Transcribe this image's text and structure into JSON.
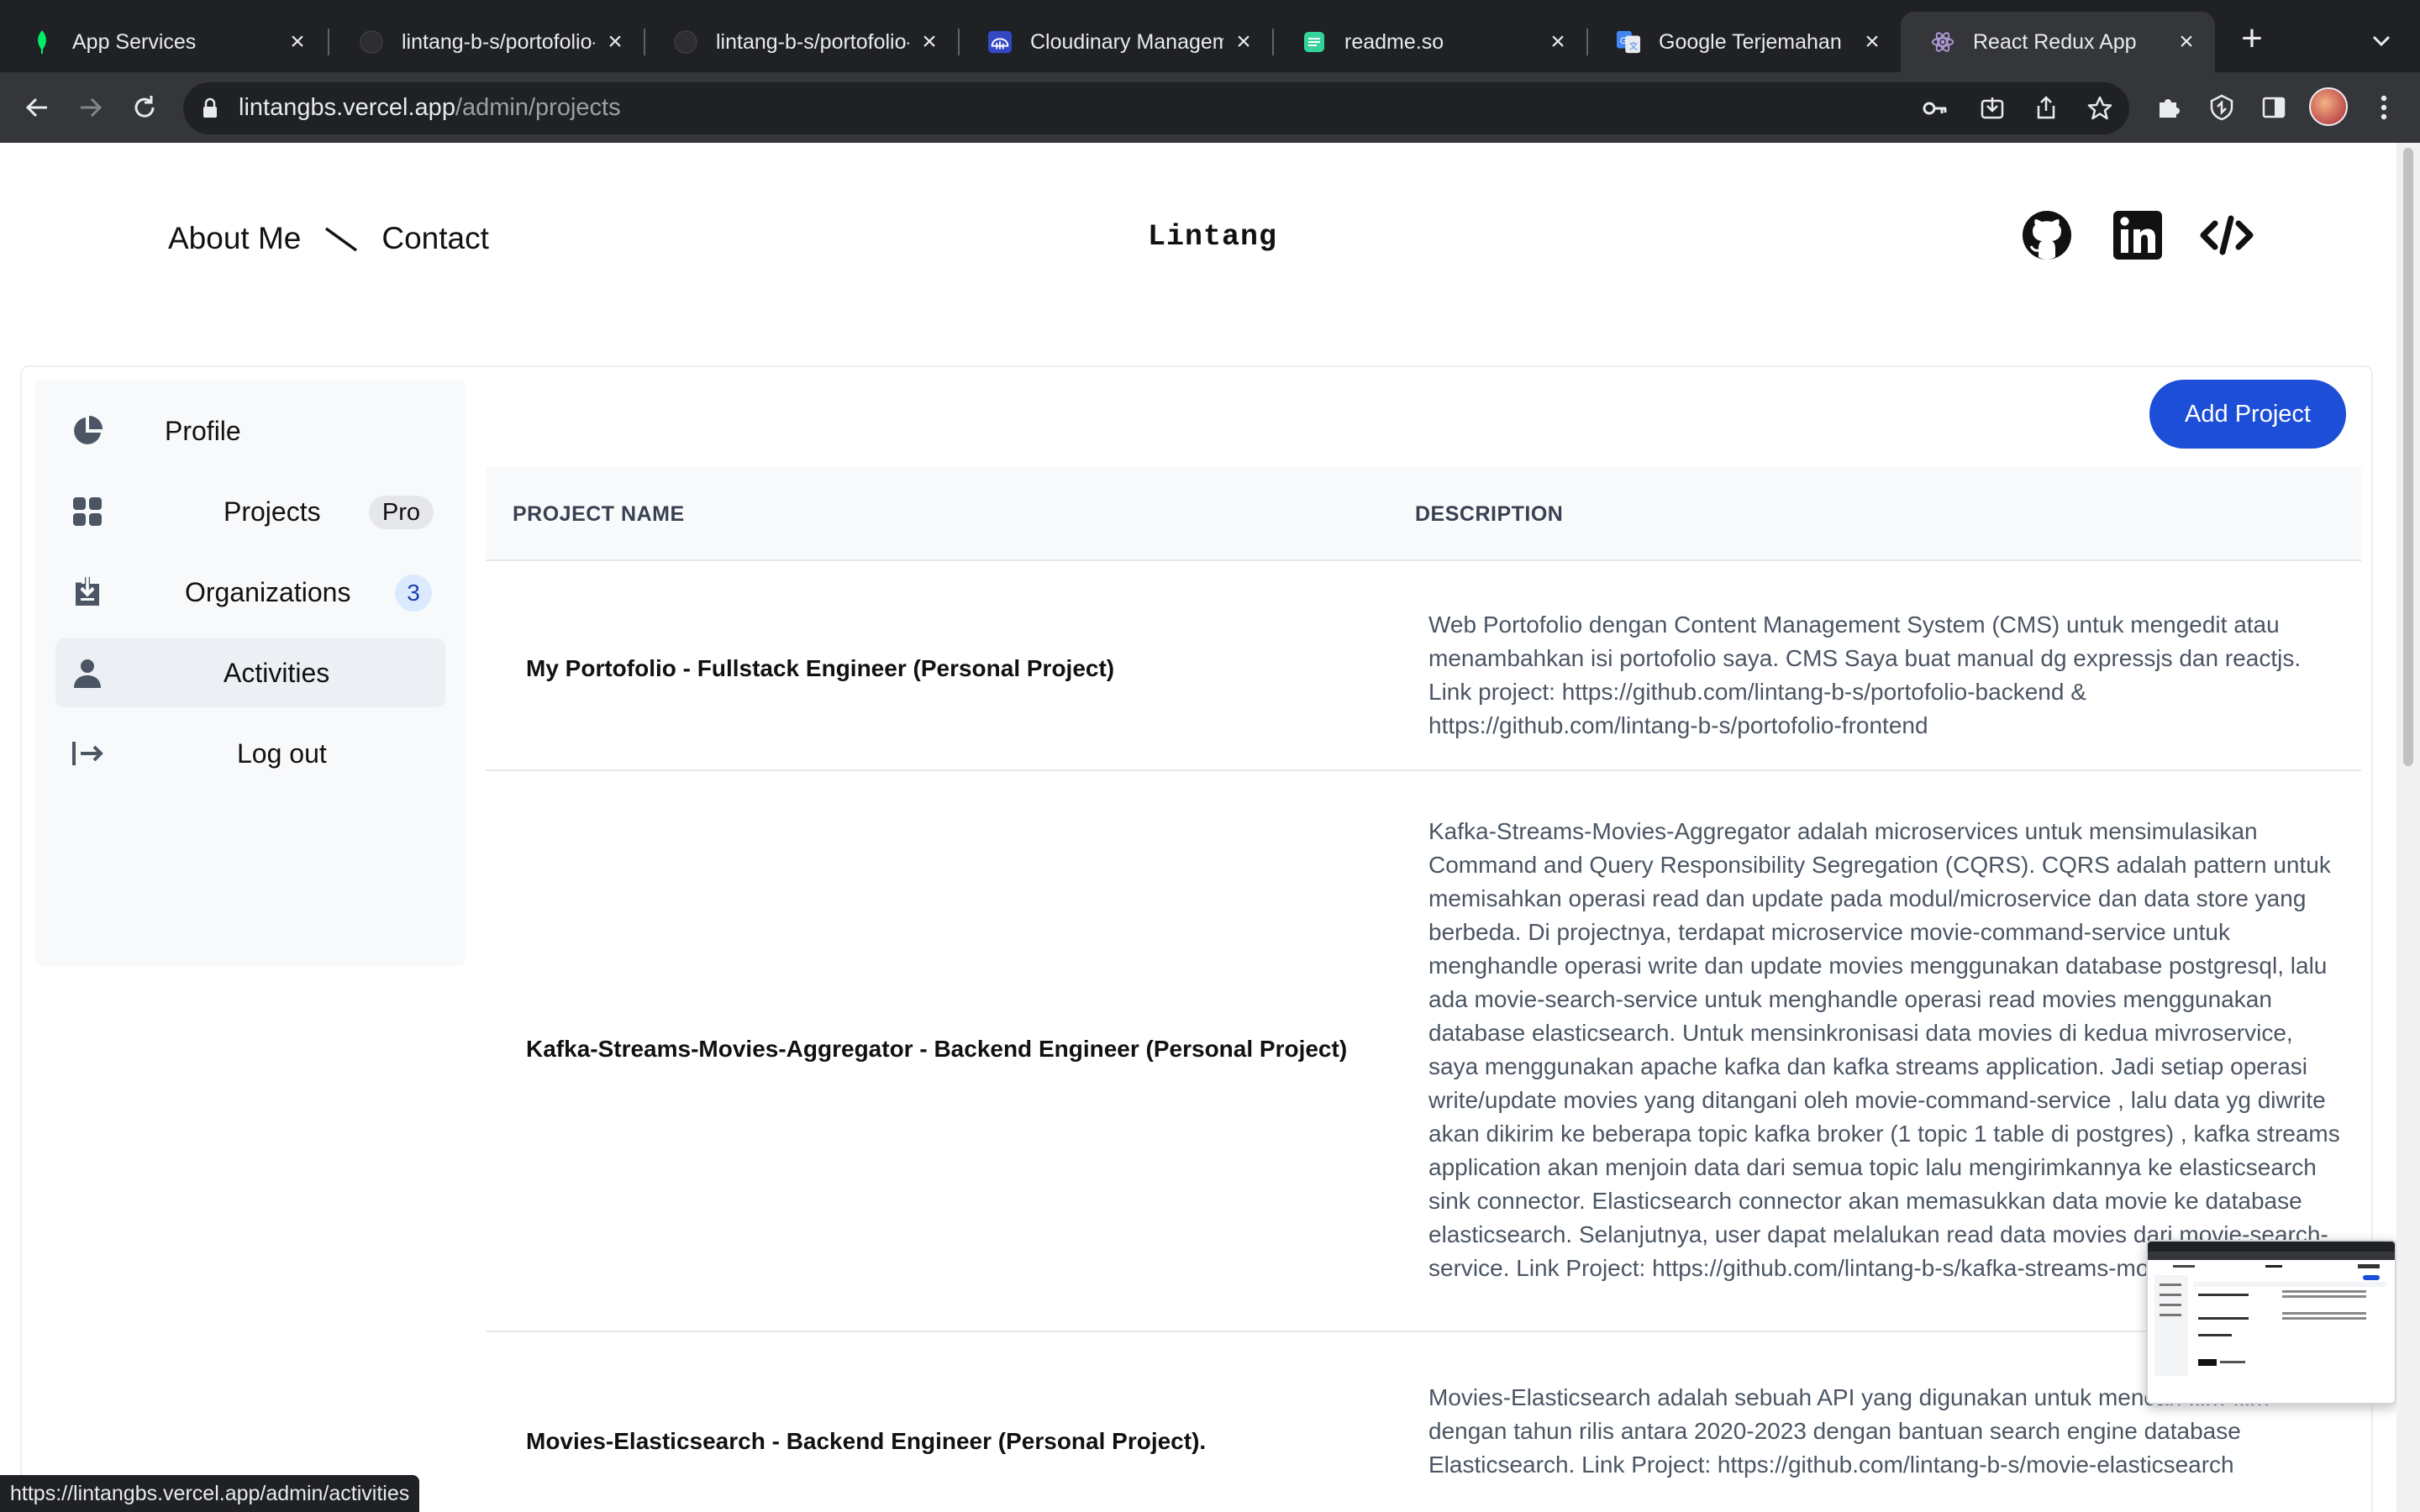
{
  "browser": {
    "tabs": [
      {
        "title": "App Services",
        "icon": "mongodb-leaf-icon"
      },
      {
        "title": "lintang-b-s/portofolio-",
        "icon": "github-icon"
      },
      {
        "title": "lintang-b-s/portofolio-",
        "icon": "github-icon"
      },
      {
        "title": "Cloudinary Management",
        "icon": "cloudinary-icon"
      },
      {
        "title": "readme.so",
        "icon": "readme-so-icon"
      },
      {
        "title": "Google Terjemahan",
        "icon": "google-translate-icon"
      },
      {
        "title": "React Redux App",
        "icon": "react-redux-icon",
        "active": true
      }
    ],
    "url": {
      "host": "lintangbs.vercel.app",
      "path": "/admin/projects"
    },
    "status_url": "https://lintangbs.vercel.app/admin/activities"
  },
  "site": {
    "nav": {
      "about": "About Me",
      "contact": "Contact"
    },
    "logo": "Lintang",
    "social": [
      "github-icon",
      "linkedin-icon",
      "code-icon"
    ]
  },
  "sidebar": {
    "items": [
      {
        "label": "Profile",
        "icon": "pie-chart-icon"
      },
      {
        "label": "Projects",
        "icon": "grid-icon",
        "badge": "Pro"
      },
      {
        "label": "Organizations",
        "icon": "inbox-download-icon",
        "badge": "3"
      },
      {
        "label": "Activities",
        "icon": "user-icon",
        "active": true
      },
      {
        "label": "Log out",
        "icon": "logout-icon"
      }
    ]
  },
  "main": {
    "add_button": "Add Project",
    "columns": [
      "PROJECT NAME",
      "DESCRIPTION"
    ],
    "rows": [
      {
        "name": "My Portofolio - Fullstack Engineer (Personal Project)",
        "description": "Web Portofolio dengan Content Management System (CMS) untuk mengedit atau menambahkan isi portofolio saya. CMS Saya buat manual dg expressjs dan reactjs. Link project: https://github.com/lintang-b-s/portofolio-backend & https://github.com/lintang-b-s/portofolio-frontend"
      },
      {
        "name": "Kafka-Streams-Movies-Aggregator - Backend Engineer (Personal Project)",
        "description": "Kafka-Streams-Movies-Aggregator adalah microservices untuk mensimulasikan Command and Query Responsibility Segregation (CQRS). CQRS adalah pattern untuk memisahkan operasi read dan update pada modul/microservice dan data store yang berbeda. Di projectnya, terdapat microservice movie-command-service untuk menghandle operasi write dan update movies menggunakan database postgresql, lalu ada movie-search-service untuk menghandle operasi read movies menggunakan database elasticsearch. Untuk mensinkronisasi data movies di kedua mivroservice, saya menggunakan apache kafka dan kafka streams application. Jadi setiap operasi write/update movies yang ditangani oleh movie-command-service , lalu data yg diwrite akan dikirim ke beberapa topic kafka broker (1 topic 1 table di postgres) , kafka streams application akan menjoin data dari semua topic lalu mengirimkannya ke elasticsearch sink connector. Elasticsearch connector akan memasukkan data movie ke database elasticsearch. Selanjutnya, user dapat melalukan read data movies dari movie-search-service. Link Project: https://github.com/lintang-b-s/kafka-streams-movies-aggregator"
      },
      {
        "name": "Movies-Elasticsearch - Backend Engineer (Personal Project).",
        "description": "Movies-Elasticsearch adalah sebuah API yang digunakan untuk mencari film-film dengan tahun rilis antara 2020-2023 dengan bantuan search engine database Elasticsearch. Link Project: https://github.com/lintang-b-s/movie-elasticsearch"
      }
    ]
  }
}
